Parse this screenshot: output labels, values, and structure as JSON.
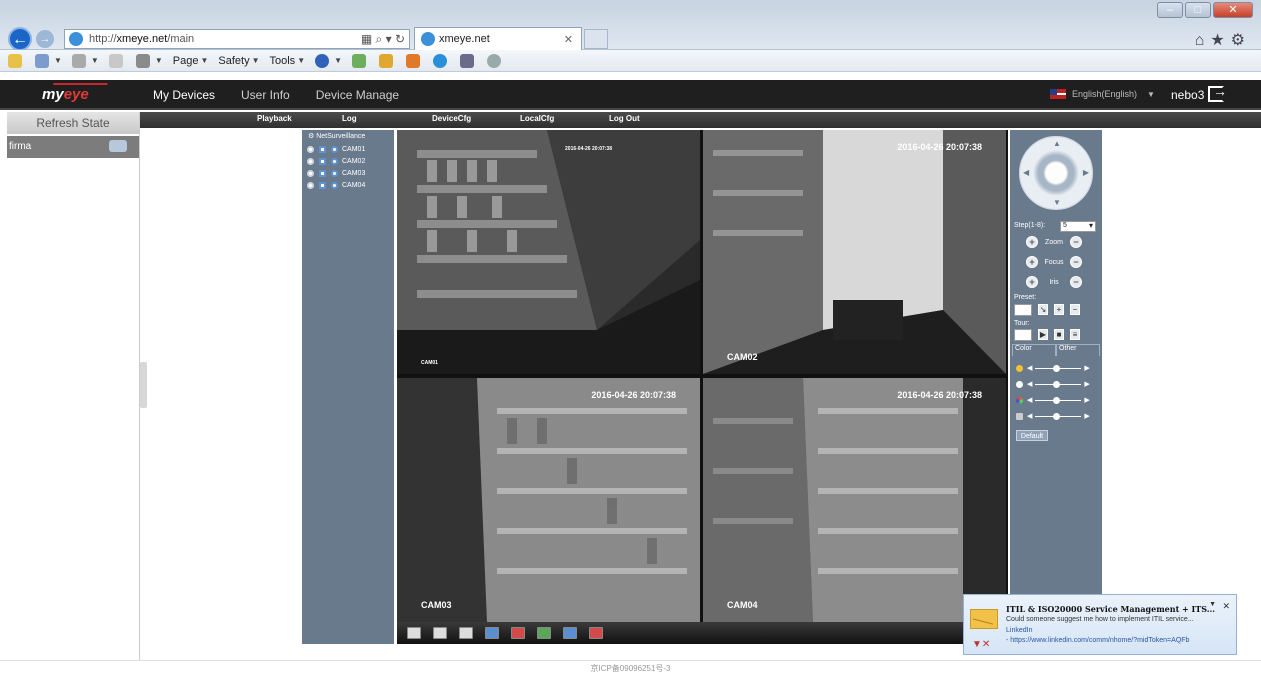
{
  "browser": {
    "address_prefix": "http://",
    "address_host": "xmeye.net",
    "address_path": "/main",
    "tab_title": "xmeye.net",
    "menus": [
      {
        "label": "Page"
      },
      {
        "label": "Safety"
      },
      {
        "label": "Tools"
      }
    ]
  },
  "app": {
    "logo_text_a": "my",
    "logo_text_b": "eye",
    "nav": [
      "My Devices",
      "User Info",
      "Device Manage"
    ],
    "language": "English(English)",
    "username": "nebo3 |",
    "submenu": [
      "Playback",
      "Log",
      "DeviceCfg",
      "LocalCfg",
      "Log Out"
    ]
  },
  "sidebar": {
    "refresh_label": "Refresh State",
    "device_name": "firma"
  },
  "tree": {
    "root_label": "NetSurveillance",
    "channels": [
      "CAM01",
      "CAM02",
      "CAM03",
      "CAM04"
    ]
  },
  "cameras": [
    {
      "name": "CAM01",
      "timestamp": "2016-04-26 20:07:38"
    },
    {
      "name": "CAM02",
      "timestamp": "2016-04-26 20:07:38"
    },
    {
      "name": "CAM03",
      "timestamp": "2016-04-26 20:07:38"
    },
    {
      "name": "CAM04",
      "timestamp": "2016-04-26 20:07:38"
    }
  ],
  "ptz": {
    "step_label": "Step(1-8):",
    "step_value": "5",
    "zoom_label": "Zoom",
    "focus_label": "Focus",
    "iris_label": "Iris",
    "preset_label": "Preset:",
    "tour_label": "Tour:",
    "tab_color": "Color",
    "tab_other": "Other",
    "default_label": "Default"
  },
  "footer": {
    "icp": "京ICP备09096251号-3"
  },
  "toast": {
    "title": "ITIL & ISO20000 Service Management + ITS...",
    "body": "Could someone suggest me how to implement ITIL service...",
    "source": "LinkedIn",
    "link": "- https://www.linkedin.com/comm/nhome/?midToken=AQFb"
  }
}
